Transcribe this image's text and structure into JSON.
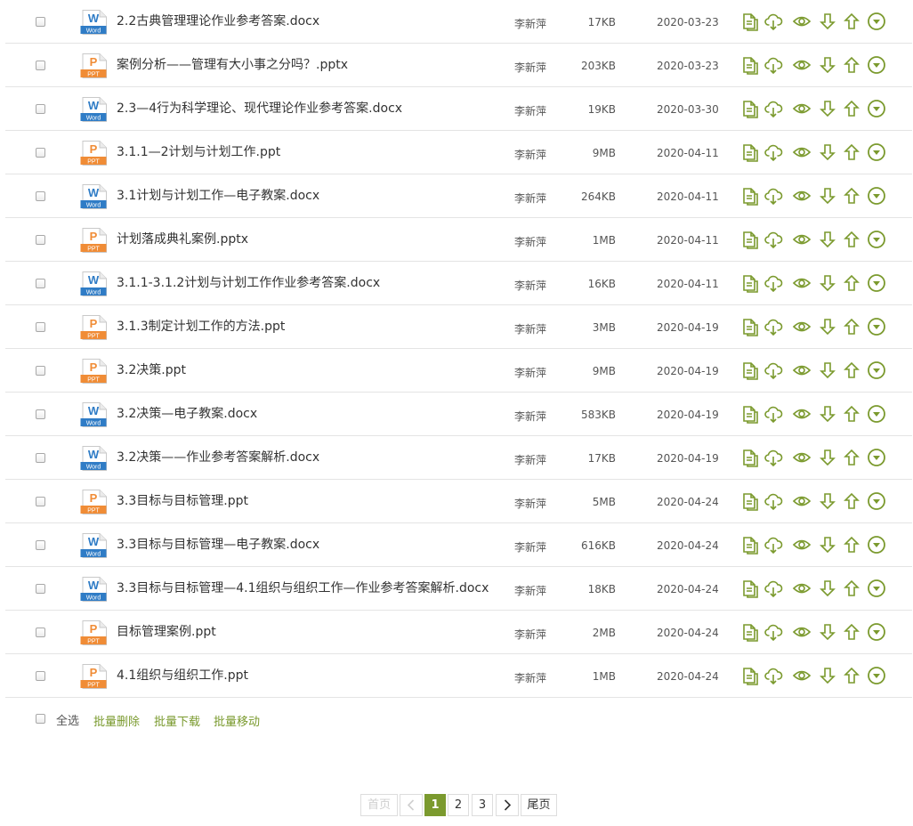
{
  "colors": {
    "accent": "#7b9a2e",
    "word_blue": "#2f7cc6",
    "ppt_orange": "#f08c36"
  },
  "files": [
    {
      "type": "word",
      "name": "2.2古典管理理论作业参考答案.docx",
      "uploader": "李新萍",
      "size": "17KB",
      "date": "2020-03-23"
    },
    {
      "type": "ppt",
      "name": "案例分析——管理有大小事之分吗？.pptx",
      "uploader": "李新萍",
      "size": "203KB",
      "date": "2020-03-23"
    },
    {
      "type": "word",
      "name": "2.3—4行为科学理论、现代理论作业参考答案.docx",
      "uploader": "李新萍",
      "size": "19KB",
      "date": "2020-03-30"
    },
    {
      "type": "ppt",
      "name": "3.1.1—2计划与计划工作.ppt",
      "uploader": "李新萍",
      "size": "9MB",
      "date": "2020-04-11"
    },
    {
      "type": "word",
      "name": "3.1计划与计划工作—电子教案.docx",
      "uploader": "李新萍",
      "size": "264KB",
      "date": "2020-04-11"
    },
    {
      "type": "ppt",
      "name": "计划落成典礼案例.pptx",
      "uploader": "李新萍",
      "size": "1MB",
      "date": "2020-04-11"
    },
    {
      "type": "word",
      "name": "3.1.1-3.1.2计划与计划工作作业参考答案.docx",
      "uploader": "李新萍",
      "size": "16KB",
      "date": "2020-04-11"
    },
    {
      "type": "ppt",
      "name": "3.1.3制定计划工作的方法.ppt",
      "uploader": "李新萍",
      "size": "3MB",
      "date": "2020-04-19"
    },
    {
      "type": "ppt",
      "name": "3.2决策.ppt",
      "uploader": "李新萍",
      "size": "9MB",
      "date": "2020-04-19"
    },
    {
      "type": "word",
      "name": "3.2决策—电子教案.docx",
      "uploader": "李新萍",
      "size": "583KB",
      "date": "2020-04-19"
    },
    {
      "type": "word",
      "name": "3.2决策——作业参考答案解析.docx",
      "uploader": "李新萍",
      "size": "17KB",
      "date": "2020-04-19"
    },
    {
      "type": "ppt",
      "name": "3.3目标与目标管理.ppt",
      "uploader": "李新萍",
      "size": "5MB",
      "date": "2020-04-24"
    },
    {
      "type": "word",
      "name": "3.3目标与目标管理—电子教案.docx",
      "uploader": "李新萍",
      "size": "616KB",
      "date": "2020-04-24"
    },
    {
      "type": "word",
      "name": "3.3目标与目标管理—4.1组织与组织工作—作业参考答案解析.docx",
      "uploader": "李新萍",
      "size": "18KB",
      "date": "2020-04-24"
    },
    {
      "type": "ppt",
      "name": "目标管理案例.ppt",
      "uploader": "李新萍",
      "size": "2MB",
      "date": "2020-04-24"
    },
    {
      "type": "ppt",
      "name": "4.1组织与组织工作.ppt",
      "uploader": "李新萍",
      "size": "1MB",
      "date": "2020-04-24"
    }
  ],
  "icon_labels": {
    "word_letter": "W",
    "word_text": "Word",
    "ppt_letter": "P",
    "ppt_text": "PPT"
  },
  "row_actions": [
    "copy-icon",
    "cloud-download-icon",
    "preview-eye-icon",
    "move-down-icon",
    "move-up-icon",
    "more-dropdown-icon"
  ],
  "batch": {
    "select_all": "全选",
    "delete": "批量删除",
    "download": "批量下载",
    "move": "批量移动"
  },
  "pagination": {
    "first": "首页",
    "prev": "‹",
    "pages": [
      "1",
      "2",
      "3"
    ],
    "current": "1",
    "next": "›",
    "last": "尾页"
  }
}
